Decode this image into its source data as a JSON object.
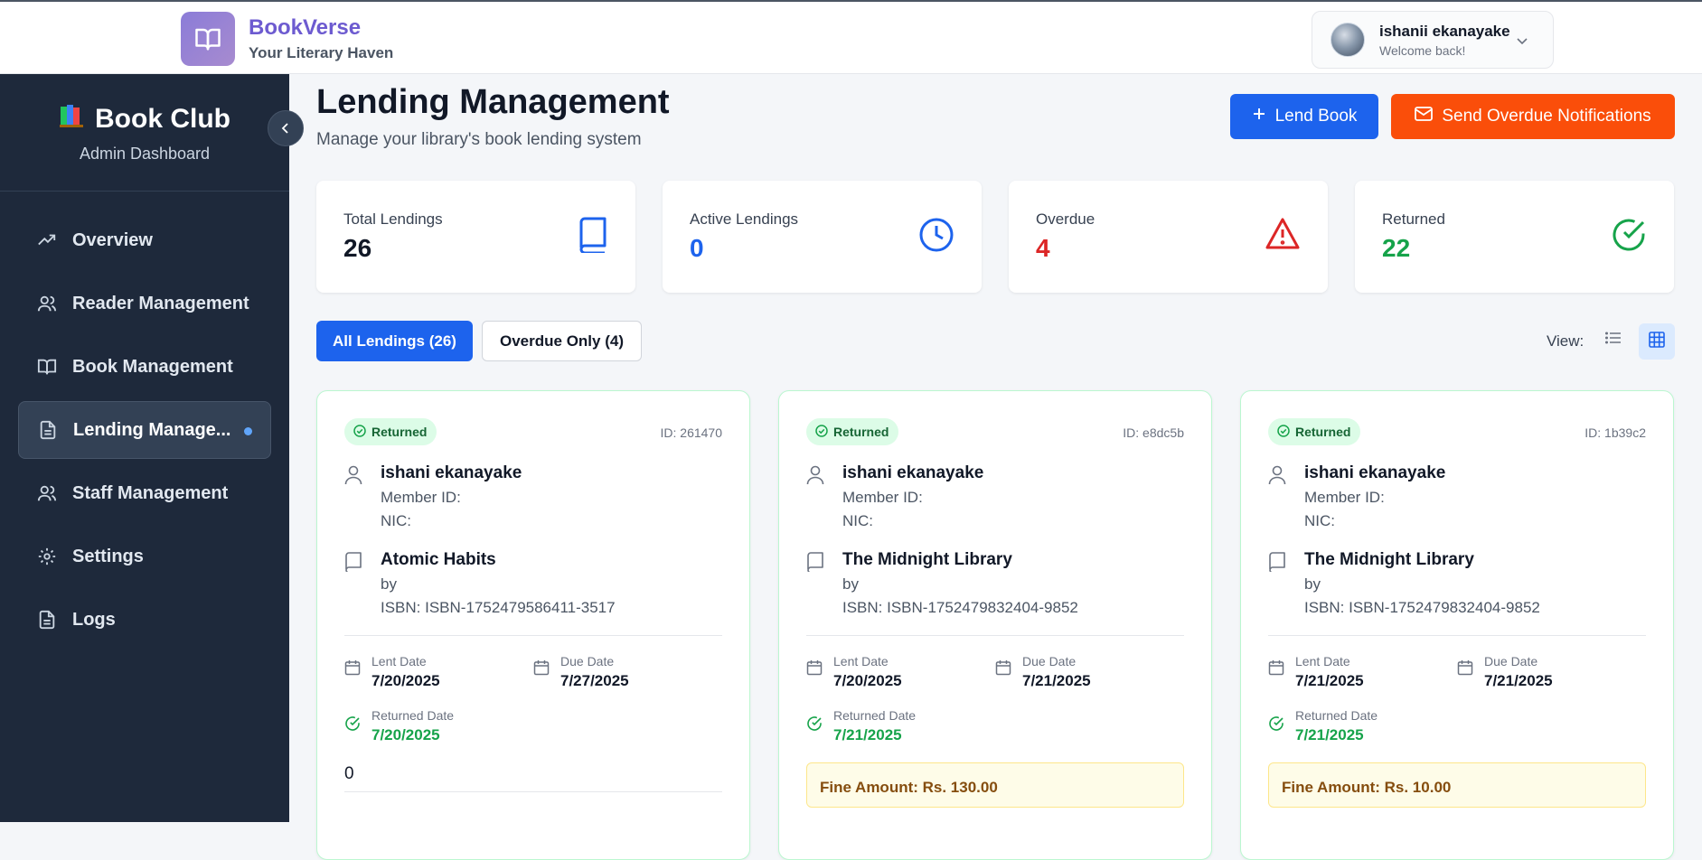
{
  "brand": {
    "name": "BookVerse",
    "tagline": "Your Literary Haven"
  },
  "user": {
    "name": "ishanii ekanayake",
    "welcome": "Welcome back!"
  },
  "sidebar": {
    "title": "Book Club",
    "subtitle": "Admin Dashboard",
    "items": [
      {
        "label": "Overview",
        "icon": "trending-up-icon"
      },
      {
        "label": "Reader Management",
        "icon": "users-icon"
      },
      {
        "label": "Book Management",
        "icon": "open-book-icon"
      },
      {
        "label": "Lending Manage...",
        "icon": "document-icon",
        "active": true
      },
      {
        "label": "Staff Management",
        "icon": "users-icon"
      },
      {
        "label": "Settings",
        "icon": "gear-icon"
      },
      {
        "label": "Logs",
        "icon": "document-icon"
      }
    ]
  },
  "page": {
    "title": "Lending Management",
    "subtitle": "Manage your library's book lending system",
    "lend_button": "Lend Book",
    "notify_button": "Send Overdue Notifications"
  },
  "stats": [
    {
      "label": "Total Lendings",
      "value": "26",
      "color": "#111827",
      "icon": "book-icon"
    },
    {
      "label": "Active Lendings",
      "value": "0",
      "color": "#1d63ed",
      "icon": "clock-icon"
    },
    {
      "label": "Overdue",
      "value": "4",
      "color": "#dc2626",
      "icon": "alert-triangle-icon"
    },
    {
      "label": "Returned",
      "value": "22",
      "color": "#16a34a",
      "icon": "check-circle-icon"
    }
  ],
  "filters": {
    "all": "All Lendings (26)",
    "overdue": "Overdue Only (4)",
    "view_label": "View:"
  },
  "cards": [
    {
      "status": "Returned",
      "id": "ID: 261470",
      "reader": "ishani ekanayake",
      "member_id": "Member ID:",
      "nic": "NIC:",
      "book": "Atomic Habits",
      "by": "by",
      "isbn": "ISBN: ISBN-1752479586411-3517",
      "lent_label": "Lent Date",
      "lent": "7/20/2025",
      "due_label": "Due Date",
      "due": "7/27/2025",
      "returned_label": "Returned Date",
      "returned": "7/20/2025",
      "extra": "0"
    },
    {
      "status": "Returned",
      "id": "ID: e8dc5b",
      "reader": "ishani ekanayake",
      "member_id": "Member ID:",
      "nic": "NIC:",
      "book": "The Midnight Library",
      "by": "by",
      "isbn": "ISBN: ISBN-1752479832404-9852",
      "lent_label": "Lent Date",
      "lent": "7/20/2025",
      "due_label": "Due Date",
      "due": "7/21/2025",
      "returned_label": "Returned Date",
      "returned": "7/21/2025",
      "fine": "Fine Amount: Rs. 130.00"
    },
    {
      "status": "Returned",
      "id": "ID: 1b39c2",
      "reader": "ishani ekanayake",
      "member_id": "Member ID:",
      "nic": "NIC:",
      "book": "The Midnight Library",
      "by": "by",
      "isbn": "ISBN: ISBN-1752479832404-9852",
      "lent_label": "Lent Date",
      "lent": "7/21/2025",
      "due_label": "Due Date",
      "due": "7/21/2025",
      "returned_label": "Returned Date",
      "returned": "7/21/2025",
      "fine": "Fine Amount: Rs. 10.00"
    }
  ]
}
